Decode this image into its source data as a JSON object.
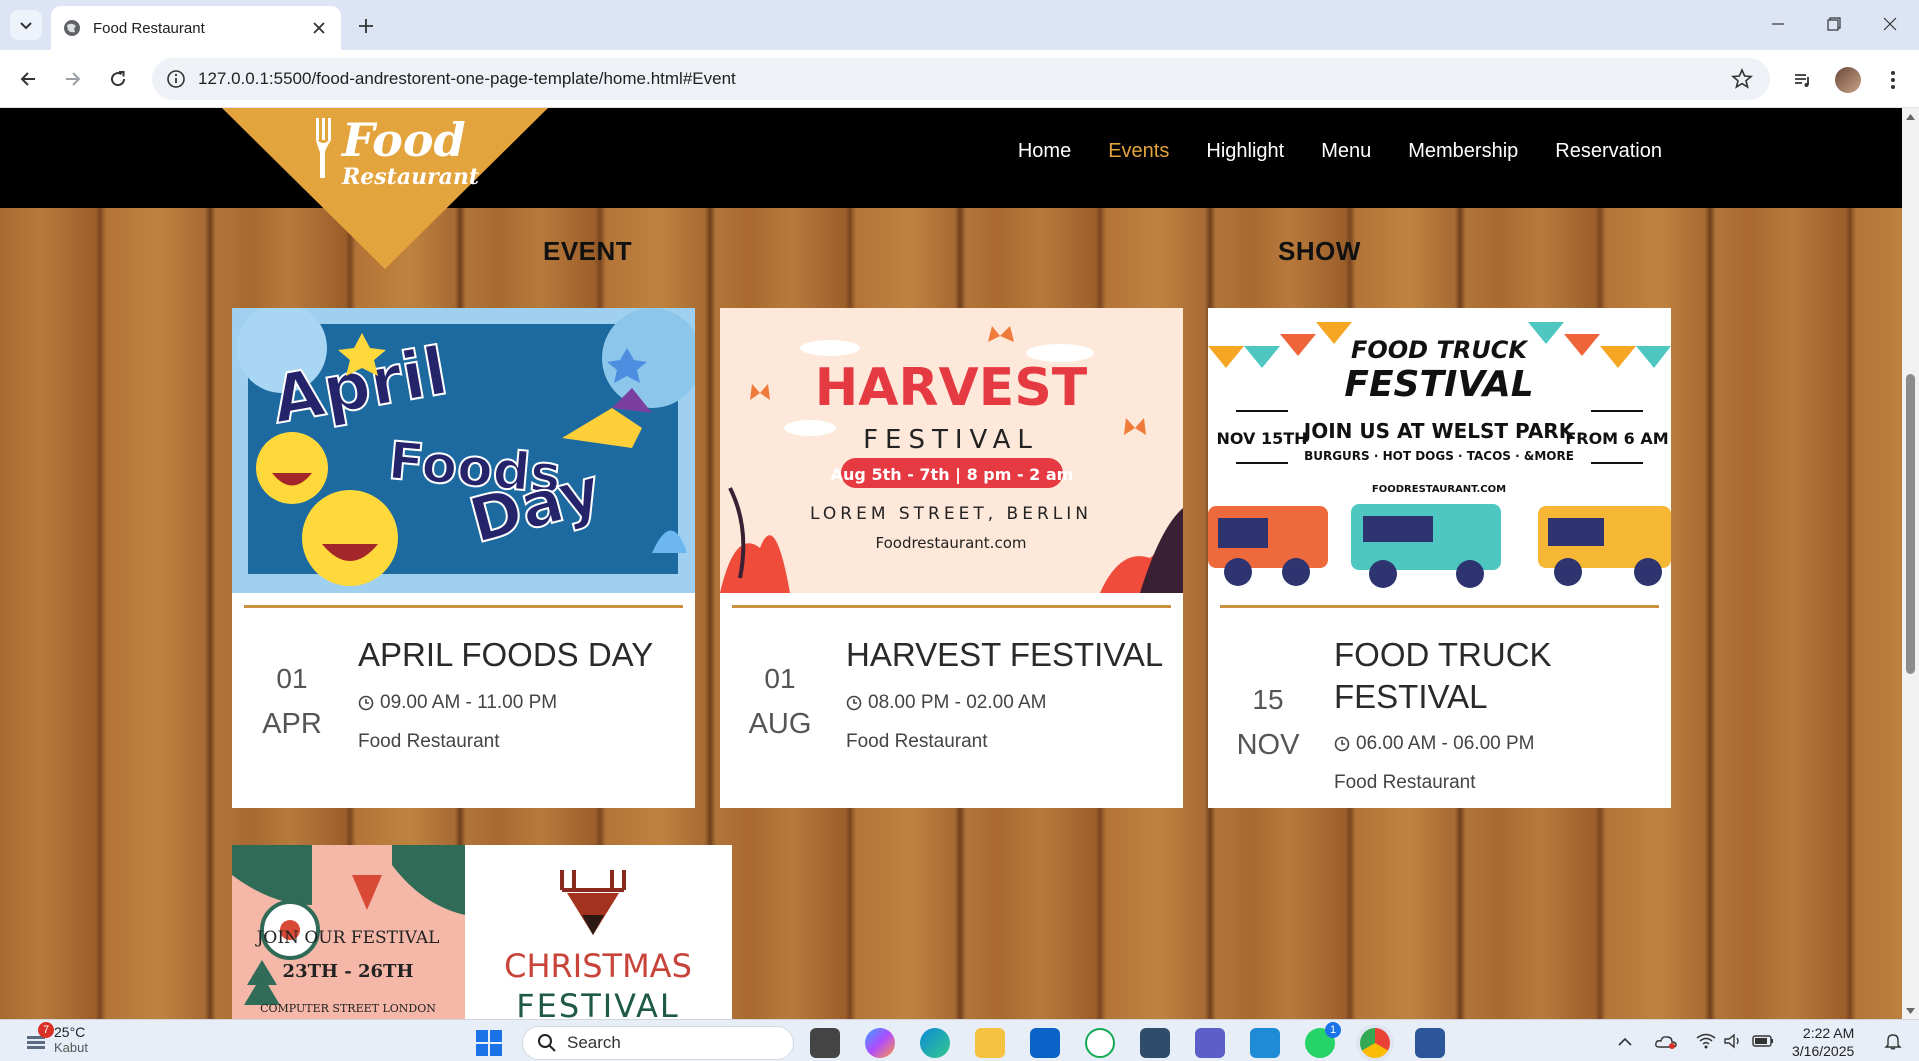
{
  "browser": {
    "tab_title": "Food Restaurant",
    "url": "127.0.0.1:5500/food-andrestorent-one-page-template/home.html#Event"
  },
  "site": {
    "logo_line1": "Food",
    "logo_line2": "Restaurant",
    "nav": [
      {
        "label": "Home",
        "active": false
      },
      {
        "label": "Events",
        "active": true
      },
      {
        "label": "Highlight",
        "active": false
      },
      {
        "label": "Menu",
        "active": false
      },
      {
        "label": "Membership",
        "active": false
      },
      {
        "label": "Reservation",
        "active": false
      }
    ],
    "heading_left": "EVENT",
    "heading_right": "SHOW"
  },
  "events": [
    {
      "day": "01",
      "month": "APR",
      "name": "APRIL FOODS DAY",
      "time": "09.00 AM - 11.00 PM",
      "venue": "Food Restaurant",
      "poster": {
        "line1": "April",
        "line2": "Foods",
        "line3": "Day"
      }
    },
    {
      "day": "01",
      "month": "AUG",
      "name": "HARVEST FESTIVAL",
      "time": "08.00 PM - 02.00 AM",
      "venue": "Food Restaurant",
      "poster": {
        "title": "HARVEST",
        "subtitle": "FESTIVAL",
        "dates": "Aug 5th - 7th | 8 pm - 2 am",
        "street": "LOREM STREET, BERLIN",
        "site": "Foodrestaurant.com"
      }
    },
    {
      "day": "15",
      "month": "NOV",
      "name": "FOOD TRUCK FESTIVAL",
      "time": "06.00 AM - 06.00 PM",
      "venue": "Food Restaurant",
      "poster": {
        "title1": "FOOD TRUCK",
        "title2": "FESTIVAL",
        "left_date": "NOV 15TH",
        "right_date": "FROM 6 AM",
        "join": "JOIN US AT WELST PARK",
        "foods": "BURGURS · HOT DOGS · TACOS · &MORE",
        "site": "FOODRESTAURANT.COM"
      }
    }
  ],
  "christmas_poster": {
    "join": "JOIN OUR FESTIVAL",
    "dates": "23TH - 26TH",
    "street": "COMPUTER STREET LONDON",
    "title1": "CHRISTMAS",
    "title2": "FESTIVAL"
  },
  "taskbar": {
    "weather_badge": "7",
    "temperature": "25°C",
    "condition": "Kabut",
    "search_label": "Search",
    "whatsapp_badge": "1",
    "time": "2:22 AM",
    "date": "3/16/2025"
  },
  "colors": {
    "accent": "#e2a33c",
    "header_bg": "#000000",
    "card_rule": "#c8913c"
  }
}
